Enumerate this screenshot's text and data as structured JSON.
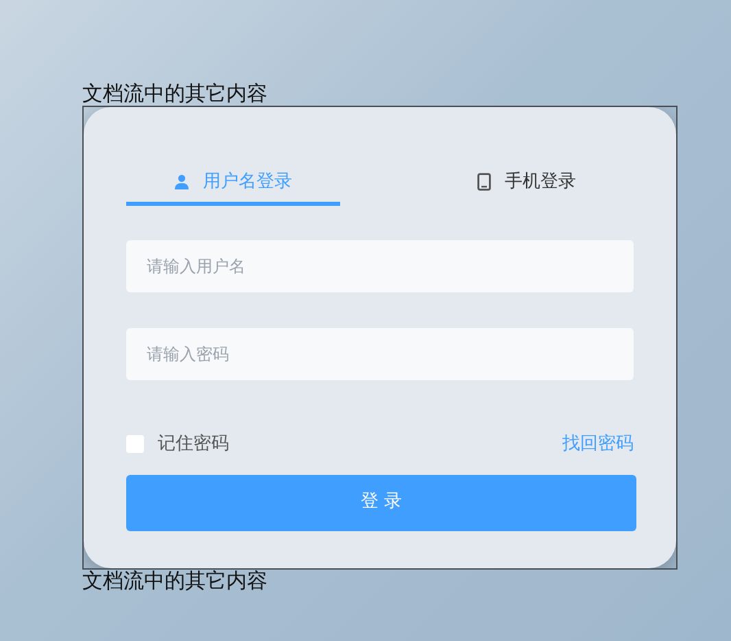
{
  "text_before": "文档流中的其它内容",
  "tabs": [
    {
      "label": "用户名登录",
      "kind": "user",
      "selected": true
    },
    {
      "label": "手机登录",
      "kind": "phone",
      "selected": false
    }
  ],
  "fields": [
    {
      "placeholder": "请输入用户名"
    },
    {
      "placeholder": "请输入密码"
    }
  ],
  "remember": {
    "label": "记住密码",
    "checked": false
  },
  "forgot_link": "找回密码",
  "login_button": "登 录",
  "text_after": "文档流中的其它内容"
}
